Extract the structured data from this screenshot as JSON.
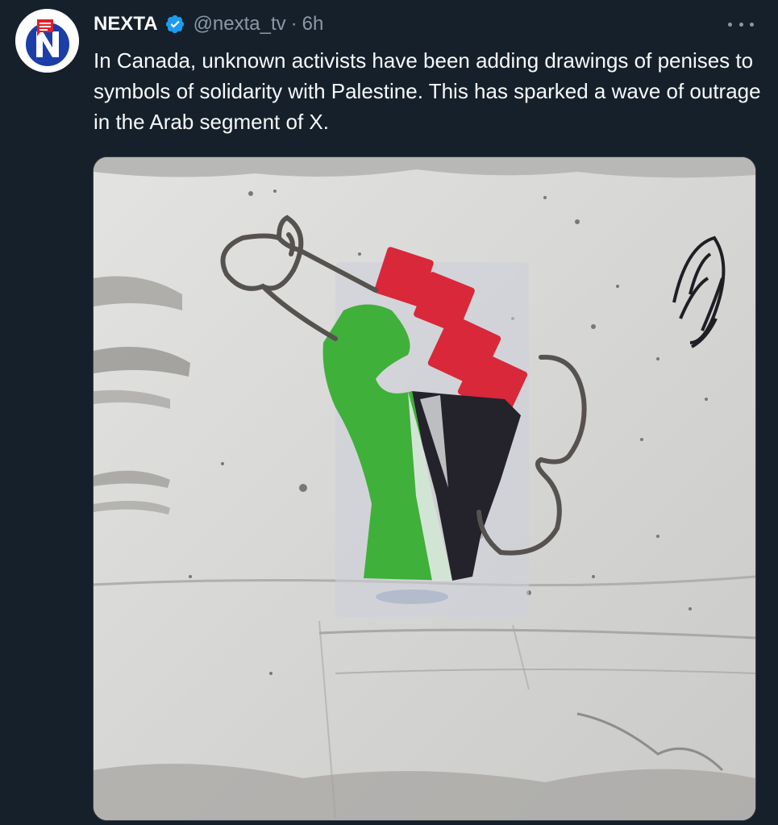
{
  "tweet": {
    "display_name": "NEXTA",
    "handle": "@nexta_tv",
    "separator": "·",
    "time": "6h",
    "text": "In Canada, unknown activists have been adding drawings of penises to symbols of solidarity with Palestine. This has sparked a wave of outrage in the Arab segment of X.",
    "verified": true
  },
  "avatar": {
    "letter": "N",
    "icon": "nexta-logo"
  },
  "media": {
    "type": "photo"
  },
  "colors": {
    "background": "#15202b",
    "text": "#f7f9f9",
    "secondary_text": "#8b98a5",
    "verified_badge": "#1d9bf0",
    "brand_blue": "#1d3ea8",
    "brand_red": "#e0202a"
  },
  "icons": {
    "verified": "verified-badge-icon",
    "more": "more-horizontal-icon"
  }
}
